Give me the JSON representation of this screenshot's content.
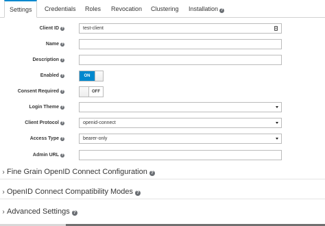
{
  "tabs": [
    {
      "label": "Settings",
      "active": true
    },
    {
      "label": "Credentials",
      "active": false
    },
    {
      "label": "Roles",
      "active": false
    },
    {
      "label": "Revocation",
      "active": false
    },
    {
      "label": "Clustering",
      "active": false
    },
    {
      "label": "Installation",
      "active": false
    }
  ],
  "help_glyph": "?",
  "form": {
    "client_id": {
      "label": "Client ID",
      "value": "test-client"
    },
    "name": {
      "label": "Name",
      "value": ""
    },
    "description": {
      "label": "Description",
      "value": ""
    },
    "enabled": {
      "label": "Enabled",
      "state": "ON"
    },
    "consent_required": {
      "label": "Consent Required",
      "state": "OFF"
    },
    "login_theme": {
      "label": "Login Theme",
      "value": ""
    },
    "client_protocol": {
      "label": "Client Protocol",
      "value": "openid-connect"
    },
    "access_type": {
      "label": "Access Type",
      "value": "bearer-only"
    },
    "admin_url": {
      "label": "Admin URL",
      "value": ""
    }
  },
  "sections": [
    {
      "label": "Fine Grain OpenID Connect Configuration"
    },
    {
      "label": "OpenID Connect Compatibility Modes"
    },
    {
      "label": "Advanced Settings"
    }
  ],
  "icons": {
    "help": "help-circle-icon",
    "collapse": "chevron-right-icon",
    "copy": "clipboard-icon",
    "select": "caret-down-icon"
  },
  "colors": {
    "accent": "#0088ce",
    "help_icon": "#6a6e73"
  }
}
